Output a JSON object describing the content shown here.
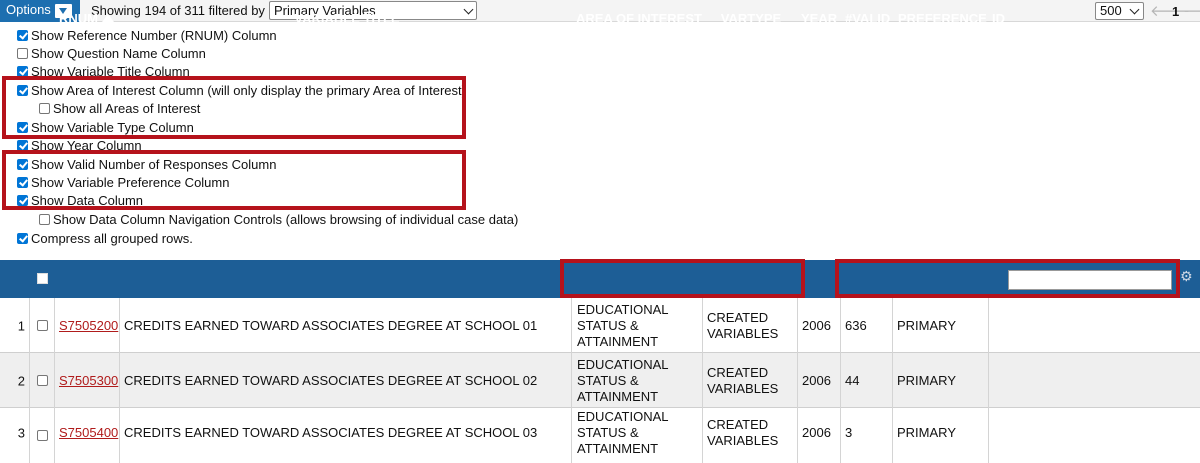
{
  "topbar": {
    "options_label": "Options",
    "showing_text": "Showing 194 of 311  filtered by",
    "filter_value": "Primary Variables",
    "page_size": "500",
    "prev_arrow": "🡐",
    "next_arrow": "🡒",
    "page_number": "1"
  },
  "options": [
    {
      "label": "Show Reference Number (RNUM) Column",
      "checked": true
    },
    {
      "label": "Show Question Name Column",
      "checked": false
    },
    {
      "label": "Show Variable Title Column",
      "checked": true
    },
    {
      "label": "Show Area of Interest Column (will only display the primary Area of Interest)",
      "checked": true
    },
    {
      "label": "Show all Areas of Interest",
      "checked": false
    },
    {
      "label": "Show Variable Type Column",
      "checked": true
    },
    {
      "label": "Show Year Column",
      "checked": true
    },
    {
      "label": "Show Valid Number of Responses Column",
      "checked": true
    },
    {
      "label": "Show Variable Preference Column",
      "checked": true
    },
    {
      "label": "Show Data Column",
      "checked": true
    },
    {
      "label": "Show Data Column Navigation Controls (allows browsing of individual case data)",
      "checked": false
    },
    {
      "label": "Compress all grouped rows.",
      "checked": true
    }
  ],
  "table": {
    "headers": {
      "rnum": "RNUM",
      "variable_title": "VARIABLE TITLE",
      "area_of_interest": "AREA OF INTEREST",
      "vartype": "VARTYPE",
      "year": "YEAR",
      "valid": "#VALID",
      "preference": "PREFERENCE",
      "id": "ID"
    },
    "rows": [
      {
        "num": "1",
        "rnum": "S7505200",
        "title": "CREDITS EARNED TOWARD ASSOCIATES DEGREE AT SCHOOL 01",
        "area": [
          "EDUCATIONAL",
          "STATUS &",
          "ATTAINMENT"
        ],
        "vartype": [
          "CREATED",
          "VARIABLES"
        ],
        "year": "2006",
        "valid": "636",
        "preference": "PRIMARY"
      },
      {
        "num": "2",
        "rnum": "S7505300",
        "title": "CREDITS EARNED TOWARD ASSOCIATES DEGREE AT SCHOOL 02",
        "area": [
          "EDUCATIONAL",
          "STATUS &",
          "ATTAINMENT"
        ],
        "vartype": [
          "CREATED",
          "VARIABLES"
        ],
        "year": "2006",
        "valid": "44",
        "preference": "PRIMARY"
      },
      {
        "num": "3",
        "rnum": "S7505400",
        "title": "CREDITS EARNED TOWARD ASSOCIATES DEGREE AT SCHOOL 03",
        "area": [
          "EDUCATIONAL",
          "STATUS &",
          "ATTAINMENT"
        ],
        "vartype": [
          "CREATED",
          "VARIABLES"
        ],
        "year": "2006",
        "valid": "3",
        "preference": "PRIMARY"
      }
    ]
  },
  "colors": {
    "header_bg": "#1d5e96",
    "options_btn": "#1d6fb0",
    "highlight": "#b5121b",
    "link": "#b01b1b"
  }
}
